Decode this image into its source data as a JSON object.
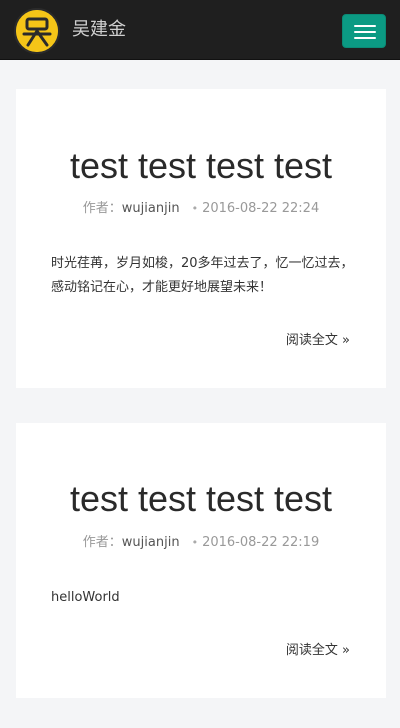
{
  "header": {
    "brand": "吴建金",
    "logo_icon": "face-logo-icon",
    "menu_icon": "hamburger-menu-icon",
    "accent_color": "#0b9a83",
    "bar_color": "#1f1f1f"
  },
  "posts": [
    {
      "title": "test test test test",
      "author_label": "作者：",
      "author": "wujianjin",
      "separator": "•",
      "date": "2016-08-22 22:24",
      "excerpt": "时光荏苒，岁月如梭，20多年过去了，忆一忆过去，感动铭记在心，才能更好地展望未来！",
      "read_more": "阅读全文 »"
    },
    {
      "title": "test test test test",
      "author_label": "作者：",
      "author": "wujianjin",
      "separator": "•",
      "date": "2016-08-22 22:19",
      "excerpt": "helloWorld",
      "read_more": "阅读全文 »"
    }
  ]
}
